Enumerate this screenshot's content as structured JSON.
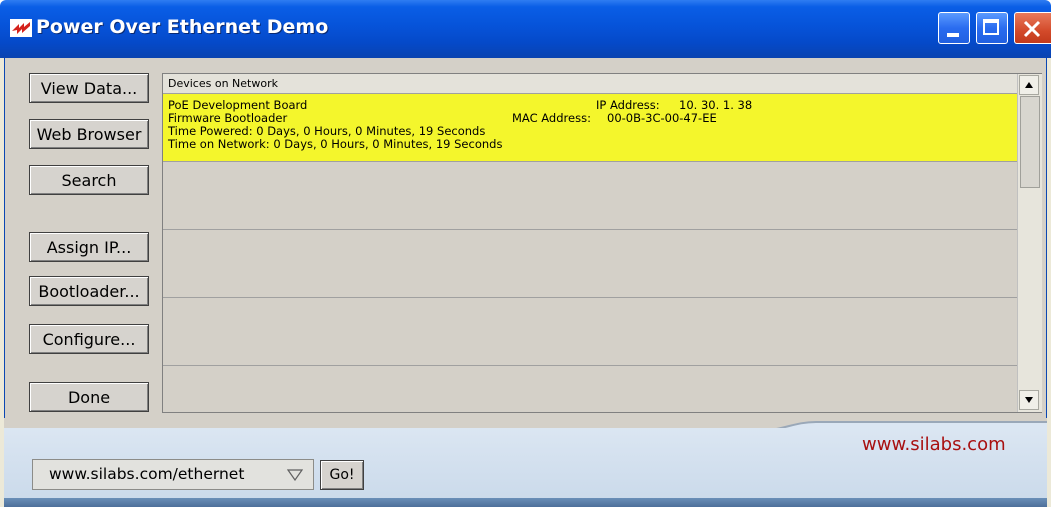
{
  "window": {
    "title": "Power Over Ethernet Demo"
  },
  "sidebar": {
    "buttons": [
      {
        "label": "View Data..."
      },
      {
        "label": "Web Browser"
      },
      {
        "label": "Search"
      },
      {
        "label": "Assign IP..."
      },
      {
        "label": "Bootloader..."
      },
      {
        "label": "Configure..."
      },
      {
        "label": "Done"
      }
    ]
  },
  "device_list": {
    "header": "Devices on Network",
    "devices": [
      {
        "name": "PoE Development Board",
        "ip_label": "IP Address:",
        "ip": "10. 30.  1. 38",
        "firmware": "Firmware Bootloader",
        "mac_label": "MAC Address:",
        "mac": "00-0B-3C-00-47-EE",
        "time_powered": "Time Powered: 0 Days,  0 Hours,  0 Minutes, 19 Seconds",
        "time_on_network": "Time on Network: 0 Days,  0 Hours,  0 Minutes, 19 Seconds"
      }
    ]
  },
  "footer": {
    "url": "www.silabs.com/ethernet",
    "go_label": "Go!",
    "brand_link": "www.silabs.com"
  },
  "colors": {
    "titlebar": "#0653d9",
    "selected_row": "#f4f62c",
    "brand_red": "#a81010"
  }
}
